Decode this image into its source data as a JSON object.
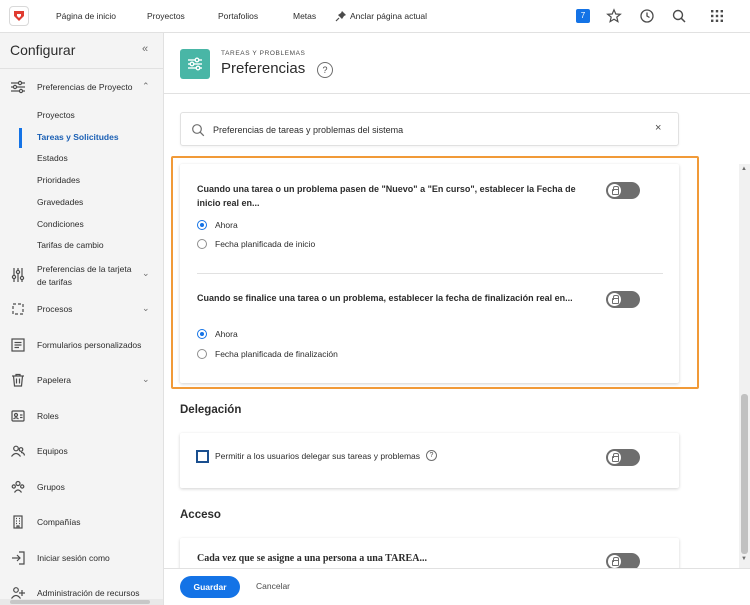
{
  "topbar": {
    "nav": [
      "Página de inicio",
      "Proyectos",
      "Portafolios",
      "Metas"
    ],
    "pin_label": "Anclar página actual",
    "badge": "7"
  },
  "sidebar": {
    "title": "Configurar",
    "collapse": "«",
    "project_prefs": "Preferencias de Proyecto",
    "subitems": [
      "Proyectos",
      "Tareas y Solicitudes",
      "Estados",
      "Prioridades",
      "Gravedades",
      "Condiciones",
      "Tarifas de cambio"
    ],
    "timesheet_prefs": "Preferencias de la tarjeta de tarifas",
    "processes": "Procesos",
    "custom_forms": "Formularios personalizados",
    "trash": "Papelera",
    "roles": "Roles",
    "teams": "Equipos",
    "groups": "Grupos",
    "companies": "Compañías",
    "login_as": "Iniciar sesión como",
    "resource_admin": "Administración de recursos"
  },
  "header": {
    "kicker": "TAREAS Y PROBLEMAS",
    "title": "Preferencias",
    "help": "?"
  },
  "search": {
    "value": "Preferencias de tareas y problemas del sistema",
    "clear": "×"
  },
  "settings": {
    "q1": "Cuando una tarea o un problema pasen de \"Nuevo\" a \"En curso\", establecer la Fecha de inicio real en...",
    "q1_options": [
      "Ahora",
      "Fecha planificada de inicio"
    ],
    "q2": "Cuando se finalice una tarea o un problema, establecer la fecha de finalización real en...",
    "q2_options": [
      "Ahora",
      "Fecha planificada de finalización"
    ]
  },
  "delegation": {
    "heading": "Delegación",
    "label": "Permitir a los usuarios delegar sus tareas y problemas",
    "help": "?"
  },
  "access": {
    "heading": "Acceso",
    "question": "Cada vez que se asigne a una persona a una TAREA..."
  },
  "footer": {
    "save": "Guardar",
    "cancel": "Cancelar"
  },
  "colors": {
    "accent": "#1473e6",
    "highlight": "#f19a38",
    "header_icon": "#49b6a6"
  }
}
